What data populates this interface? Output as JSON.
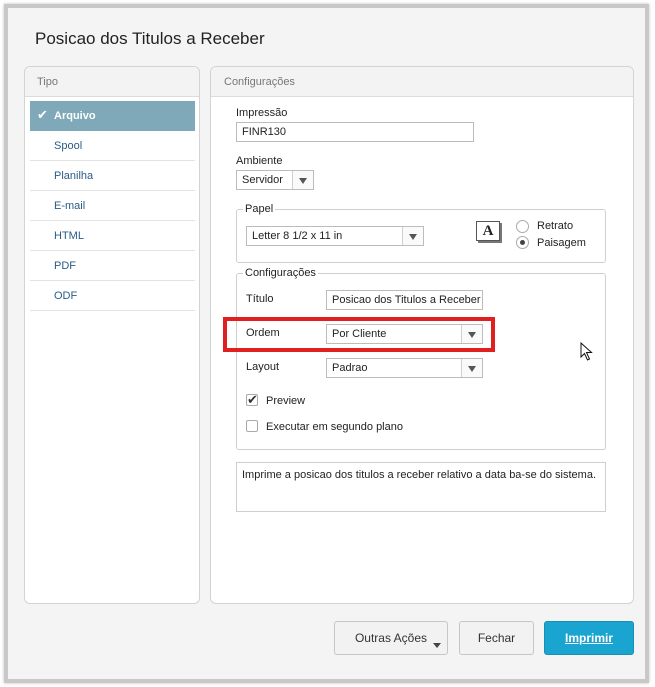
{
  "dialog": {
    "title": "Posicao dos Titulos a Receber"
  },
  "left_panel": {
    "header": "Tipo",
    "items": [
      {
        "label": "Arquivo",
        "selected": true
      },
      {
        "label": "Spool"
      },
      {
        "label": "Planilha"
      },
      {
        "label": "E-mail"
      },
      {
        "label": "HTML"
      },
      {
        "label": "PDF"
      },
      {
        "label": "ODF"
      }
    ]
  },
  "right_panel": {
    "header": "Configurações",
    "impressao": {
      "label": "Impressão",
      "value": "FINR130"
    },
    "ambiente": {
      "label": "Ambiente",
      "value": "Servidor"
    },
    "papel": {
      "legend": "Papel",
      "size": "Letter 8 1/2 x 11 in",
      "icon_letter": "A",
      "orientation": [
        {
          "label": "Retrato",
          "checked": false
        },
        {
          "label": "Paisagem",
          "checked": true
        }
      ]
    },
    "config": {
      "legend": "Configurações",
      "titulo": {
        "label": "Título",
        "value": "Posicao dos Titulos a Receber"
      },
      "ordem": {
        "label": "Ordem",
        "value": "Por Cliente"
      },
      "layout": {
        "label": "Layout",
        "value": "Padrao"
      },
      "preview": {
        "label": "Preview",
        "checked": true
      },
      "background": {
        "label": "Executar em segundo plano",
        "checked": false
      }
    },
    "description": "Imprime a posicao dos titulos a receber relativo a data ba-se do sistema."
  },
  "footer": {
    "more_actions": "Outras Ações",
    "close": "Fechar",
    "print": "Imprimir"
  },
  "colors": {
    "selected_item": "#7fa9b8",
    "primary_button": "#1aa4d0",
    "highlight": "#e02020"
  }
}
